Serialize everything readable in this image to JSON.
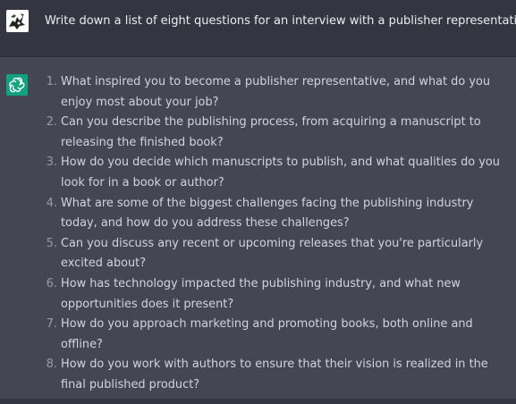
{
  "conversation": {
    "user_message": "Write down a list of eight questions for an interview with a publisher representative.",
    "assistant_answers": [
      {
        "num": "1.",
        "text": "What inspired you to become a publisher representative, and what do you enjoy most about your job?"
      },
      {
        "num": "2.",
        "text": "Can you describe the publishing process, from acquiring a manuscript to releasing the finished book?"
      },
      {
        "num": "3.",
        "text": "How do you decide which manuscripts to publish, and what qualities do you look for in a book or author?"
      },
      {
        "num": "4.",
        "text": "What are some of the biggest challenges facing the publishing industry today, and how do you address these challenges?"
      },
      {
        "num": "5.",
        "text": "Can you discuss any recent or upcoming releases that you're particularly excited about?"
      },
      {
        "num": "6.",
        "text": "How has technology impacted the publishing industry, and what new opportunities does it present?"
      },
      {
        "num": "7.",
        "text": "How do you approach marketing and promoting books, both online and offline?"
      },
      {
        "num": "8.",
        "text": "How do you work with authors to ensure that their vision is realized in the final published product?"
      }
    ]
  },
  "icons": {
    "user_avatar": "user-avatar-icon",
    "assistant_avatar": "openai-logo-icon"
  },
  "colors": {
    "user_row_bg": "#343541",
    "assistant_row_bg": "#444654",
    "assistant_avatar_bg": "#10a37f",
    "text": "#d1d5db"
  }
}
